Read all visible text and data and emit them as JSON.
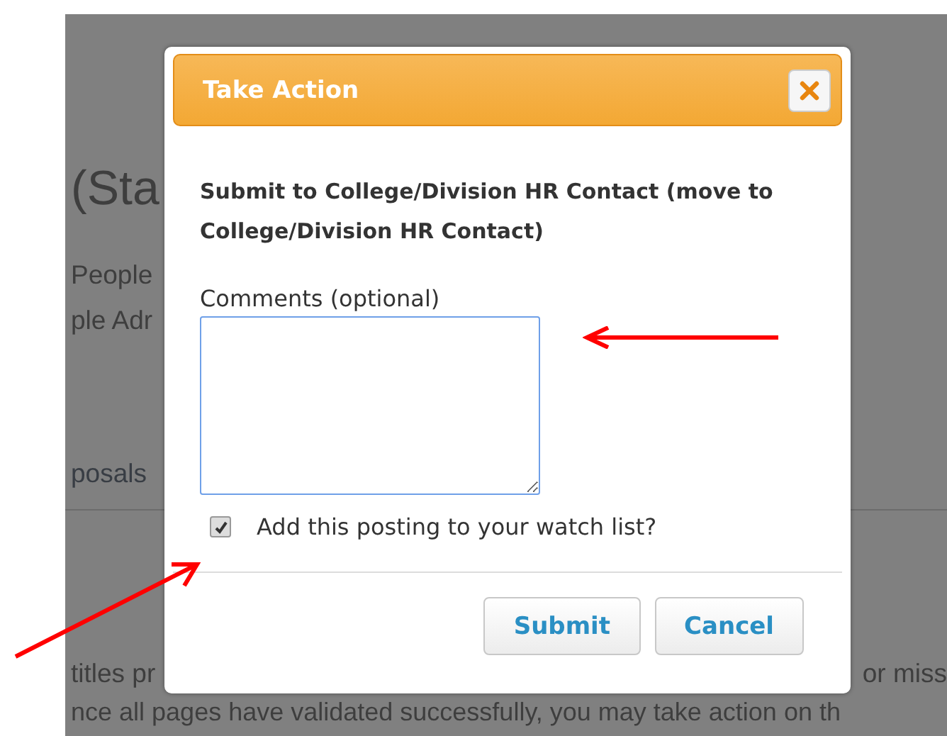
{
  "background_page": {
    "heading": "(Sta",
    "line_1": "People",
    "line_2": "ple Adr",
    "tab": "posals",
    "paragraph_left": "titles pr",
    "paragraph_right": "or miss",
    "paragraph_line_2": "nce all pages have validated successfully, you may take action on th"
  },
  "dialog": {
    "title": "Take Action",
    "message": "Submit to College/Division HR Contact (move to College/Division HR Contact)",
    "comments_label": "Comments (optional)",
    "watch_list": {
      "label": "Add this posting to your watch list?",
      "checked": true
    },
    "buttons": [
      {
        "label": "Submit"
      },
      {
        "label": "Cancel"
      }
    ]
  }
}
